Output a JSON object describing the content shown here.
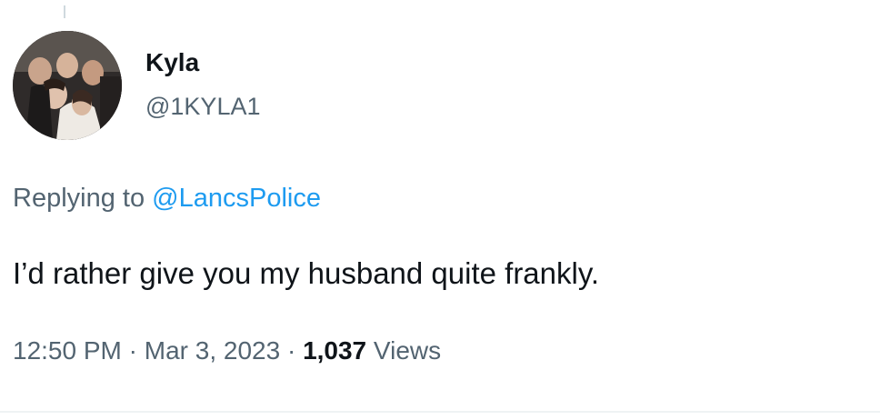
{
  "tweet": {
    "author": {
      "display_name": "Kyla",
      "handle": "@1KYLA1"
    },
    "replying_to": {
      "prefix": "Replying to",
      "mention": "@LancsPolice"
    },
    "text": "I’d rather give you my husband quite frankly.",
    "meta": {
      "time": "12:50 PM",
      "separator": "·",
      "date": "Mar 3, 2023",
      "views_count": "1,037",
      "views_label": "Views"
    }
  },
  "colors": {
    "text_primary": "#0f1419",
    "text_secondary": "#536471",
    "link": "#1d9bf0"
  }
}
